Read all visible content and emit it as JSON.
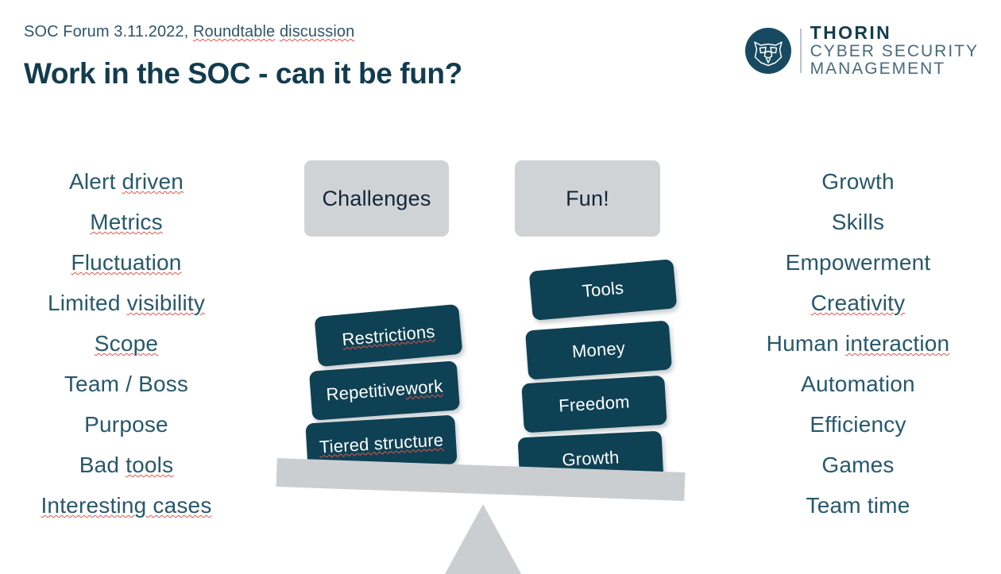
{
  "header": {
    "eyebrow_plain": "SOC Forum 3.11.2022, ",
    "eyebrow_misspelled_1": "Roundtable",
    "eyebrow_space": " ",
    "eyebrow_misspelled_2": "discussion",
    "title": "Work in the SOC - can it be fun?"
  },
  "logo": {
    "icon": "bear-head-icon",
    "line1": "THORIN",
    "line2": "CYBER SECURITY",
    "line3": "MANAGEMENT"
  },
  "left_column": {
    "items": [
      {
        "plain": "Alert ",
        "flagged": "driven",
        "tail": ""
      },
      {
        "plain": "",
        "flagged": "Metrics",
        "tail": ""
      },
      {
        "plain": "",
        "flagged": "Fluctuation",
        "tail": ""
      },
      {
        "plain": "Limited ",
        "flagged": "visibility",
        "tail": ""
      },
      {
        "plain": "",
        "flagged": "Scope",
        "tail": ""
      },
      {
        "plain": "Team / Boss",
        "flagged": "",
        "tail": ""
      },
      {
        "plain": "Purpose",
        "flagged": "",
        "tail": ""
      },
      {
        "plain": "Bad ",
        "flagged": "tools",
        "tail": ""
      },
      {
        "plain": "",
        "flagged": "Interesting cases",
        "tail": ""
      }
    ]
  },
  "right_column": {
    "items": [
      {
        "plain": "Growth",
        "flagged": "",
        "tail": ""
      },
      {
        "plain": "Skills",
        "flagged": "",
        "tail": ""
      },
      {
        "plain": "Empowerment",
        "flagged": "",
        "tail": ""
      },
      {
        "plain": "",
        "flagged": "Creativity",
        "tail": ""
      },
      {
        "plain": "Human ",
        "flagged": "interaction",
        "tail": ""
      },
      {
        "plain": "Automation",
        "flagged": "",
        "tail": ""
      },
      {
        "plain": "Efficiency",
        "flagged": "",
        "tail": ""
      },
      {
        "plain": "Games",
        "flagged": "",
        "tail": ""
      },
      {
        "plain": "Team time",
        "flagged": "",
        "tail": ""
      }
    ]
  },
  "scale": {
    "challenges_label": "Challenges",
    "fun_label": "Fun!",
    "challenges_blocks": [
      {
        "plain": "",
        "flagged": "Restrictions",
        "tail": ""
      },
      {
        "plain": "Repetitive ",
        "flagged": "work",
        "tail": ""
      },
      {
        "plain": "",
        "flagged": "Tiered structure",
        "tail": ""
      }
    ],
    "fun_blocks": [
      {
        "plain": "Tools",
        "flagged": "",
        "tail": ""
      },
      {
        "plain": "Money",
        "flagged": "",
        "tail": ""
      },
      {
        "plain": "Freedom",
        "flagged": "",
        "tail": ""
      },
      {
        "plain": "Growth",
        "flagged": "",
        "tail": ""
      }
    ]
  },
  "colors": {
    "ink": "#123c4e",
    "body_text": "#27586b",
    "block_fill": "#0f4154",
    "caption_fill": "#d0d3d6",
    "plank_fill": "#cbced1",
    "spellcheck": "#e8534a",
    "background": "#ffffff"
  }
}
